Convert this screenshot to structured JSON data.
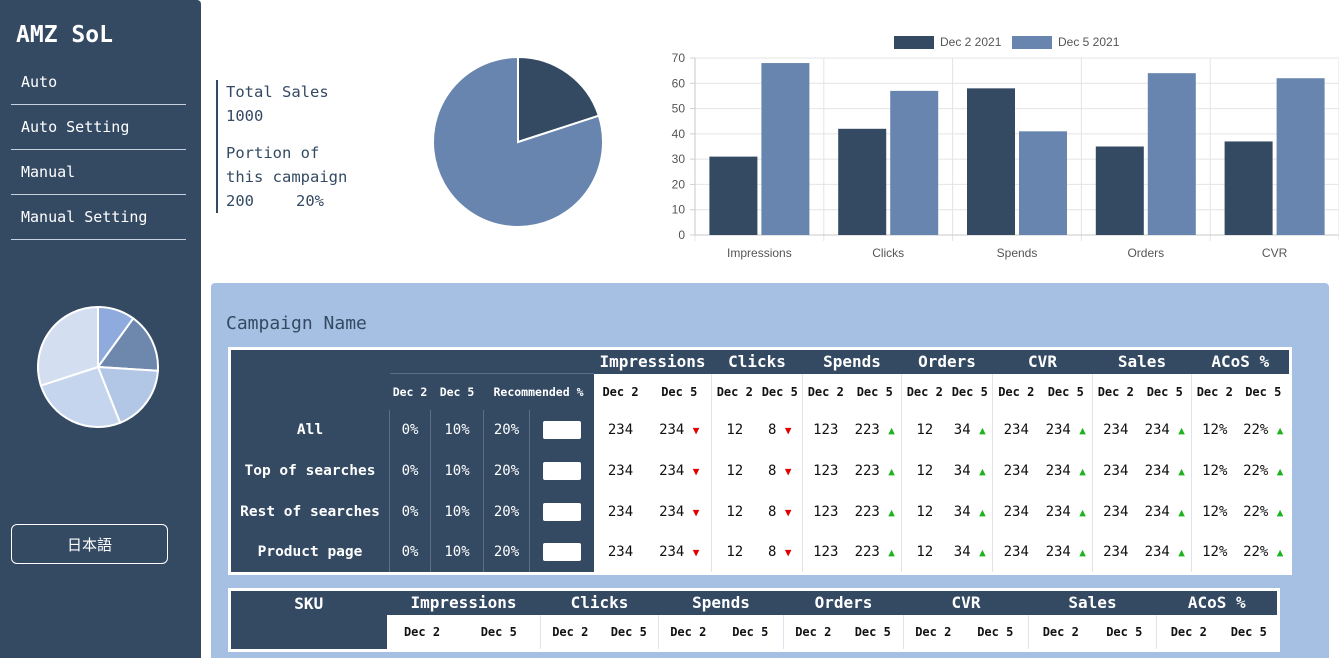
{
  "app": {
    "brand": "AMZ SoL"
  },
  "sidebar": {
    "items": [
      {
        "label": "Auto"
      },
      {
        "label": "Auto Setting"
      },
      {
        "label": "Manual"
      },
      {
        "label": "Manual Setting"
      }
    ],
    "language_button": "日本語",
    "pie_slices": [
      {
        "fraction": 0.1,
        "color": "#8faadc"
      },
      {
        "fraction": 0.16,
        "color": "#6e88ad"
      },
      {
        "fraction": 0.18,
        "color": "#b2c6e6"
      },
      {
        "fraction": 0.26,
        "color": "#c5d5ee"
      },
      {
        "fraction": 0.3,
        "color": "#d3def0"
      }
    ]
  },
  "summary": {
    "total_sales_label": "Total Sales",
    "total_sales_value": "1000",
    "portion_label_1": "Portion of",
    "portion_label_2": "this campaign",
    "portion_value": "200",
    "portion_percent": "20%"
  },
  "main_pie": {
    "slices": [
      {
        "fraction": 0.2,
        "color": "#344a63"
      },
      {
        "fraction": 0.8,
        "color": "#6785af"
      }
    ]
  },
  "chart_data": {
    "type": "bar",
    "categories": [
      "Impressions",
      "Clicks",
      "Spends",
      "Orders",
      "CVR"
    ],
    "series": [
      {
        "name": "Dec 2 2021",
        "color": "#344a63",
        "values": [
          31,
          42,
          58,
          35,
          37
        ]
      },
      {
        "name": "Dec 5 2021",
        "color": "#6785af",
        "values": [
          68,
          57,
          41,
          64,
          62
        ]
      }
    ],
    "ylim": [
      0,
      70
    ],
    "yticks": [
      0,
      10,
      20,
      30,
      40,
      50,
      60,
      70
    ],
    "grid": true,
    "legend": "top"
  },
  "campaign": {
    "title": "Campaign Name",
    "metric_groups": [
      "Impressions",
      "Clicks",
      "Spends",
      "Orders",
      "CVR",
      "Sales",
      "ACoS %"
    ],
    "date_labels": [
      "Dec 2",
      "Dec 5"
    ],
    "recommended_label": "Recommended %",
    "rows": [
      {
        "label": "All",
        "pct_dec2": "0%",
        "pct_dec5": "10%",
        "recommended": "20%",
        "metrics": [
          {
            "d2": "234",
            "d5": "234",
            "trend": "down"
          },
          {
            "d2": "12",
            "d5": "8",
            "trend": "down"
          },
          {
            "d2": "123",
            "d5": "223",
            "trend": "up"
          },
          {
            "d2": "12",
            "d5": "34",
            "trend": "up"
          },
          {
            "d2": "234",
            "d5": "234",
            "trend": "up"
          },
          {
            "d2": "234",
            "d5": "234",
            "trend": "up"
          },
          {
            "d2": "12%",
            "d5": "22%",
            "trend": "up"
          }
        ]
      },
      {
        "label": "Top of searches",
        "pct_dec2": "0%",
        "pct_dec5": "10%",
        "recommended": "20%",
        "metrics": [
          {
            "d2": "234",
            "d5": "234",
            "trend": "down"
          },
          {
            "d2": "12",
            "d5": "8",
            "trend": "down"
          },
          {
            "d2": "123",
            "d5": "223",
            "trend": "up"
          },
          {
            "d2": "12",
            "d5": "34",
            "trend": "up"
          },
          {
            "d2": "234",
            "d5": "234",
            "trend": "up"
          },
          {
            "d2": "234",
            "d5": "234",
            "trend": "up"
          },
          {
            "d2": "12%",
            "d5": "22%",
            "trend": "up"
          }
        ]
      },
      {
        "label": "Rest of searches",
        "pct_dec2": "0%",
        "pct_dec5": "10%",
        "recommended": "20%",
        "metrics": [
          {
            "d2": "234",
            "d5": "234",
            "trend": "down"
          },
          {
            "d2": "12",
            "d5": "8",
            "trend": "down"
          },
          {
            "d2": "123",
            "d5": "223",
            "trend": "up"
          },
          {
            "d2": "12",
            "d5": "34",
            "trend": "up"
          },
          {
            "d2": "234",
            "d5": "234",
            "trend": "up"
          },
          {
            "d2": "234",
            "d5": "234",
            "trend": "up"
          },
          {
            "d2": "12%",
            "d5": "22%",
            "trend": "up"
          }
        ]
      },
      {
        "label": "Product page",
        "pct_dec2": "0%",
        "pct_dec5": "10%",
        "recommended": "20%",
        "metrics": [
          {
            "d2": "234",
            "d5": "234",
            "trend": "down"
          },
          {
            "d2": "12",
            "d5": "8",
            "trend": "down"
          },
          {
            "d2": "123",
            "d5": "223",
            "trend": "up"
          },
          {
            "d2": "12",
            "d5": "34",
            "trend": "up"
          },
          {
            "d2": "234",
            "d5": "234",
            "trend": "up"
          },
          {
            "d2": "234",
            "d5": "234",
            "trend": "up"
          },
          {
            "d2": "12%",
            "d5": "22%",
            "trend": "up"
          }
        ]
      }
    ]
  },
  "sku_table": {
    "sku_label": "SKU",
    "metric_groups": [
      "Impressions",
      "Clicks",
      "Spends",
      "Orders",
      "CVR",
      "Sales",
      "ACoS %"
    ],
    "date_labels": [
      "Dec 2",
      "Dec 5"
    ]
  },
  "icons": {
    "trend_up": "▲",
    "trend_down": "▼"
  }
}
